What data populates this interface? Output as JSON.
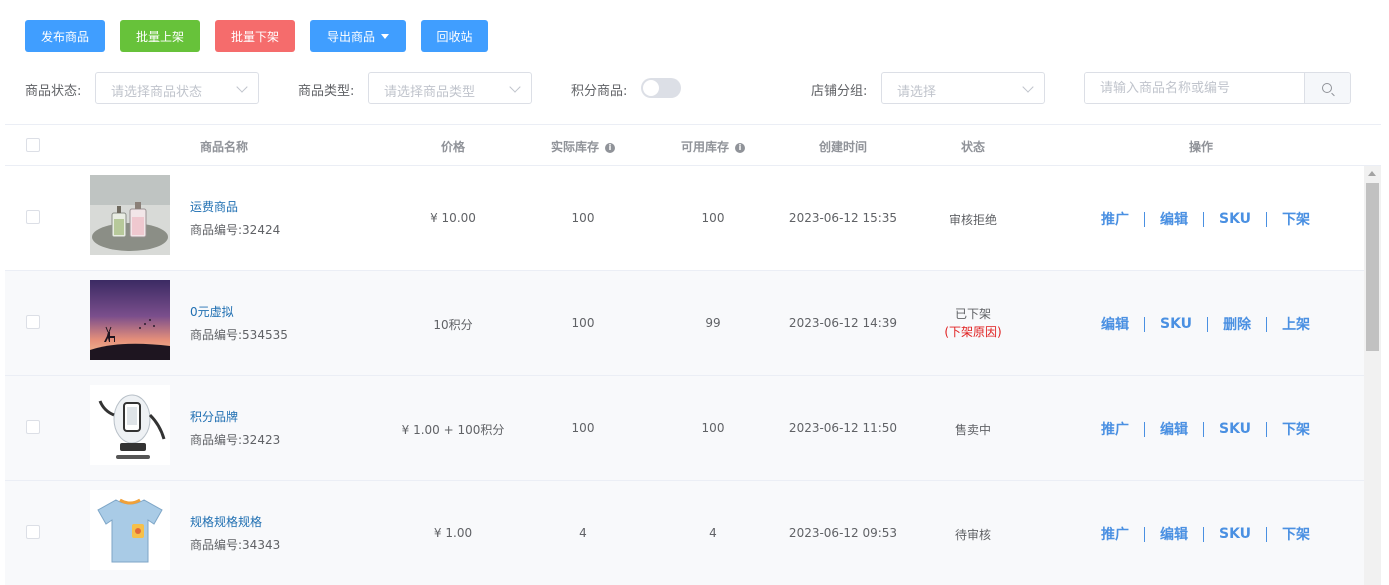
{
  "toolbar": {
    "publish": "发布商品",
    "batch_on": "批量上架",
    "batch_off": "批量下架",
    "export": "导出商品",
    "recycle": "回收站"
  },
  "filters": {
    "status_label": "商品状态:",
    "status_placeholder": "请选择商品状态",
    "type_label": "商品类型:",
    "type_placeholder": "请选择商品类型",
    "points_label": "积分商品:",
    "points_enabled": false,
    "group_label": "店铺分组:",
    "group_placeholder": "请选择",
    "search_placeholder": "请输入商品名称或编号"
  },
  "table": {
    "headers": {
      "name": "商品名称",
      "price": "价格",
      "actual_stock": "实际库存",
      "available_stock": "可用库存",
      "created": "创建时间",
      "status": "状态",
      "actions": "操作"
    },
    "rows": [
      {
        "image": "perfume-bottles-photo",
        "name": "运费商品",
        "code": "商品编号:32424",
        "price": "¥ 10.00",
        "actual_stock": "100",
        "available_stock": "100",
        "created": "2023-06-12 15:35",
        "status": "审核拒绝",
        "status_note": "",
        "actions": [
          "推广",
          "编辑",
          "SKU",
          "下架"
        ]
      },
      {
        "image": "sunset-deer-photo",
        "name": "0元虚拟",
        "code": "商品编号:534535",
        "price": "10积分",
        "actual_stock": "100",
        "available_stock": "99",
        "created": "2023-06-12 14:39",
        "status": "已下架",
        "status_note": "(下架原因)",
        "actions": [
          "编辑",
          "SKU",
          "删除",
          "上架"
        ]
      },
      {
        "image": "robot-illustration",
        "name": "积分品牌",
        "code": "商品编号:32423",
        "price": "¥ 1.00 + 100积分",
        "actual_stock": "100",
        "available_stock": "100",
        "created": "2023-06-12 11:50",
        "status": "售卖中",
        "status_note": "",
        "actions": [
          "推广",
          "编辑",
          "SKU",
          "下架"
        ]
      },
      {
        "image": "kids-tshirt-photo",
        "name": "规格规格规格",
        "code": "商品编号:34343",
        "price": "¥ 1.00",
        "actual_stock": "4",
        "available_stock": "4",
        "created": "2023-06-12 09:53",
        "status": "待审核",
        "status_note": "",
        "actions": [
          "推广",
          "编辑",
          "SKU",
          "下架"
        ]
      }
    ]
  },
  "colors": {
    "primary": "#409eff",
    "success": "#67c23a",
    "danger": "#f56c6c",
    "link": "#4a90e2",
    "reason": "#e02020"
  }
}
